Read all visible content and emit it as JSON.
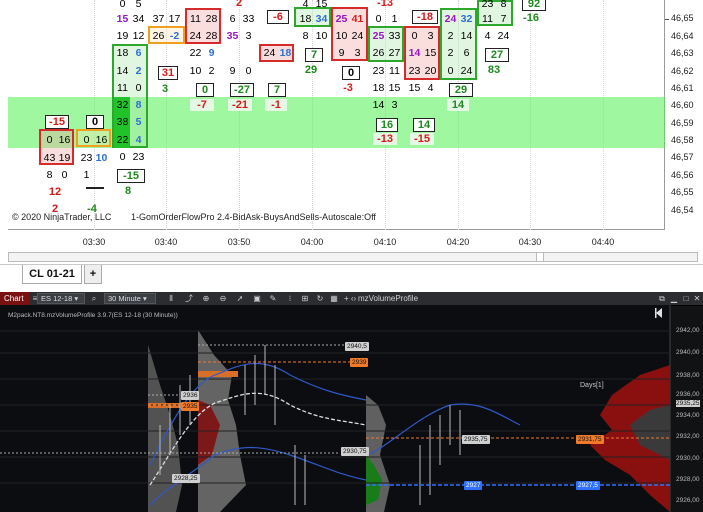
{
  "top_chart": {
    "copyright": "© 2020 NinjaTrader, LLC",
    "indicator": "1-GomOrderFlowPro 2.4-BidAsk-BuysAndSells-Autoscale:Off",
    "price_labels": [
      "46,65",
      "46,64",
      "46,63",
      "46,62",
      "46,61",
      "46,60",
      "46,59",
      "46,58",
      "46,57",
      "46,56",
      "46,55",
      "46,54"
    ],
    "time_labels": [
      "03:30",
      "03:40",
      "03:50",
      "04:00",
      "04:10",
      "04:20",
      "04:30",
      "04:40"
    ],
    "cells": [
      {
        "t": "-15",
        "c": "red"
      },
      {
        "t": "0"
      },
      {
        "t": "16"
      },
      {
        "t": "43"
      },
      {
        "t": "19"
      },
      {
        "t": "8"
      },
      {
        "t": "0"
      },
      {
        "t": "0"
      },
      {
        "t": "0"
      },
      {
        "t": "16"
      },
      {
        "t": "23"
      },
      {
        "t": "10"
      },
      {
        "t": "1"
      },
      {
        "t": "0"
      },
      {
        "t": "5"
      },
      {
        "t": "15"
      },
      {
        "t": "34"
      },
      {
        "t": "19"
      },
      {
        "t": "12"
      },
      {
        "t": "10"
      },
      {
        "t": "18"
      },
      {
        "t": "6"
      },
      {
        "t": "14"
      },
      {
        "t": "2"
      },
      {
        "t": "11"
      },
      {
        "t": "0"
      },
      {
        "t": "32"
      },
      {
        "t": "8"
      },
      {
        "t": "38"
      },
      {
        "t": "5"
      },
      {
        "t": "22"
      },
      {
        "t": "4"
      },
      {
        "t": "0"
      },
      {
        "t": "23"
      },
      {
        "t": "37"
      },
      {
        "t": "17"
      },
      {
        "t": "26"
      },
      {
        "t": "-2"
      },
      {
        "t": "31"
      },
      {
        "t": "3"
      },
      {
        "t": "11"
      },
      {
        "t": "28"
      },
      {
        "t": "24"
      },
      {
        "t": "28"
      },
      {
        "t": "22"
      },
      {
        "t": "9"
      },
      {
        "t": "10"
      },
      {
        "t": "2"
      },
      {
        "t": "0"
      },
      {
        "t": "6"
      },
      {
        "t": "33"
      },
      {
        "t": "35"
      },
      {
        "t": "3"
      },
      {
        "t": "9"
      },
      {
        "t": "0"
      },
      {
        "t": "1"
      },
      {
        "t": "12"
      },
      {
        "t": "-6"
      },
      {
        "t": "24"
      },
      {
        "t": "18"
      },
      {
        "t": "8"
      },
      {
        "t": "9"
      },
      {
        "t": "8"
      },
      {
        "t": "4"
      },
      {
        "t": "15"
      },
      {
        "t": "18"
      },
      {
        "t": "34"
      },
      {
        "t": "8"
      },
      {
        "t": "10"
      },
      {
        "t": "7"
      },
      {
        "t": "29"
      },
      {
        "t": "25"
      },
      {
        "t": "41"
      },
      {
        "t": "10"
      },
      {
        "t": "24"
      },
      {
        "t": "9"
      },
      {
        "t": "3"
      },
      {
        "t": "0"
      },
      {
        "t": "-3"
      },
      {
        "t": "-13"
      },
      {
        "t": "0"
      },
      {
        "t": "1"
      },
      {
        "t": "25"
      },
      {
        "t": "33"
      },
      {
        "t": "26"
      },
      {
        "t": "27"
      },
      {
        "t": "23"
      },
      {
        "t": "11"
      },
      {
        "t": "18"
      },
      {
        "t": "15"
      },
      {
        "t": "14"
      },
      {
        "t": "3"
      },
      {
        "t": "16"
      },
      {
        "t": "-13"
      },
      {
        "t": "-18"
      },
      {
        "t": "0"
      },
      {
        "t": "3"
      },
      {
        "t": "14"
      },
      {
        "t": "15"
      },
      {
        "t": "23"
      },
      {
        "t": "20"
      },
      {
        "t": "15"
      },
      {
        "t": "4"
      },
      {
        "t": "5"
      },
      {
        "t": "14"
      },
      {
        "t": "-15"
      },
      {
        "t": "24"
      },
      {
        "t": "32"
      },
      {
        "t": "2"
      },
      {
        "t": "14"
      },
      {
        "t": "2"
      },
      {
        "t": "6"
      },
      {
        "t": "0"
      },
      {
        "t": "24"
      },
      {
        "t": "29"
      },
      {
        "t": "14"
      },
      {
        "t": "23"
      },
      {
        "t": "8"
      },
      {
        "t": "11"
      },
      {
        "t": "7"
      },
      {
        "t": "4"
      },
      {
        "t": "24"
      },
      {
        "t": "27"
      },
      {
        "t": "83"
      },
      {
        "t": "92"
      },
      {
        "t": "-16"
      },
      {
        "t": "2"
      },
      {
        "t": "104"
      },
      {
        "t": "117"
      },
      {
        "t": "2"
      },
      {
        "t": "-4"
      },
      {
        "t": "12"
      },
      {
        "t": "-15"
      },
      {
        "t": "8"
      },
      {
        "t": "-7"
      },
      {
        "t": "-27"
      },
      {
        "t": "-21"
      },
      {
        "t": "7"
      },
      {
        "t": "-1"
      },
      {
        "t": "2"
      }
    ]
  },
  "tabs": {
    "active": "CL 01-21",
    "add": "+"
  },
  "bottom_chart": {
    "chart_tab": "Chart",
    "instrument": "ES 12-18",
    "interval": "30 Minute",
    "indicator_label": "mzVolumeProfile",
    "header_text": "M2pack.NT8.mzVolumeProfile 3.9.7(ES 12-18 (30 Minute))",
    "days_label": "Days[1]",
    "price_labels": [
      "2942,00",
      "2940,00",
      "2938,00",
      "2936,00",
      "2935,25",
      "2934,00",
      "2932,00",
      "2930,00",
      "2928,00",
      "2926,00"
    ],
    "tags": {
      "t1": "2940,5",
      "t2": "2939",
      "t3": "2936",
      "t4": "2935",
      "t5": "2930,75",
      "t6": "2928,25",
      "t7": "2935,75",
      "t8": "2931,75",
      "t9": "2927,5",
      "t10": "2927"
    },
    "colors": {
      "poc": "#f07a2a",
      "va_line": "#3070ff",
      "profile_red": "#b01010",
      "profile_gray": "#9a9a9a"
    }
  }
}
